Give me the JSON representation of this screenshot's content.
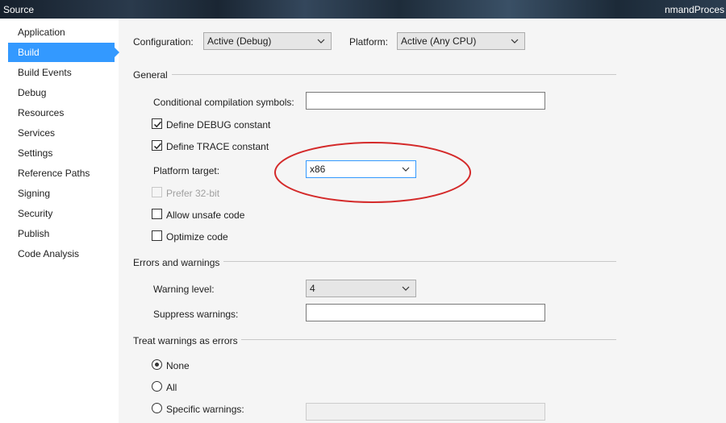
{
  "window": {
    "title_left": "Source",
    "title_right": "nmandProces"
  },
  "sidebar": {
    "items": [
      {
        "label": "Application"
      },
      {
        "label": "Build"
      },
      {
        "label": "Build Events"
      },
      {
        "label": "Debug"
      },
      {
        "label": "Resources"
      },
      {
        "label": "Services"
      },
      {
        "label": "Settings"
      },
      {
        "label": "Reference Paths"
      },
      {
        "label": "Signing"
      },
      {
        "label": "Security"
      },
      {
        "label": "Publish"
      },
      {
        "label": "Code Analysis"
      }
    ],
    "selected": "Build"
  },
  "top_bar": {
    "configuration_label": "Configuration:",
    "configuration_value": "Active (Debug)",
    "platform_label": "Platform:",
    "platform_value": "Active (Any CPU)"
  },
  "general": {
    "header": "General",
    "conditional_symbols_label": "Conditional compilation symbols:",
    "conditional_symbols_value": "",
    "define_debug_label": "Define DEBUG constant",
    "define_debug_checked": true,
    "define_trace_label": "Define TRACE constant",
    "define_trace_checked": true,
    "platform_target_label": "Platform target:",
    "platform_target_value": "x86",
    "prefer32_label": "Prefer 32-bit",
    "prefer32_checked": false,
    "allow_unsafe_label": "Allow unsafe code",
    "allow_unsafe_checked": false,
    "optimize_label": "Optimize code",
    "optimize_checked": false
  },
  "errors": {
    "header": "Errors and warnings",
    "warning_level_label": "Warning level:",
    "warning_level_value": "4",
    "suppress_label": "Suppress warnings:",
    "suppress_value": ""
  },
  "treat": {
    "header": "Treat warnings as errors",
    "none_label": "None",
    "all_label": "All",
    "specific_label": "Specific warnings:",
    "selected": "None",
    "specific_value": ""
  },
  "colors": {
    "accent": "#3399ff",
    "annotation": "#d42a2a"
  }
}
